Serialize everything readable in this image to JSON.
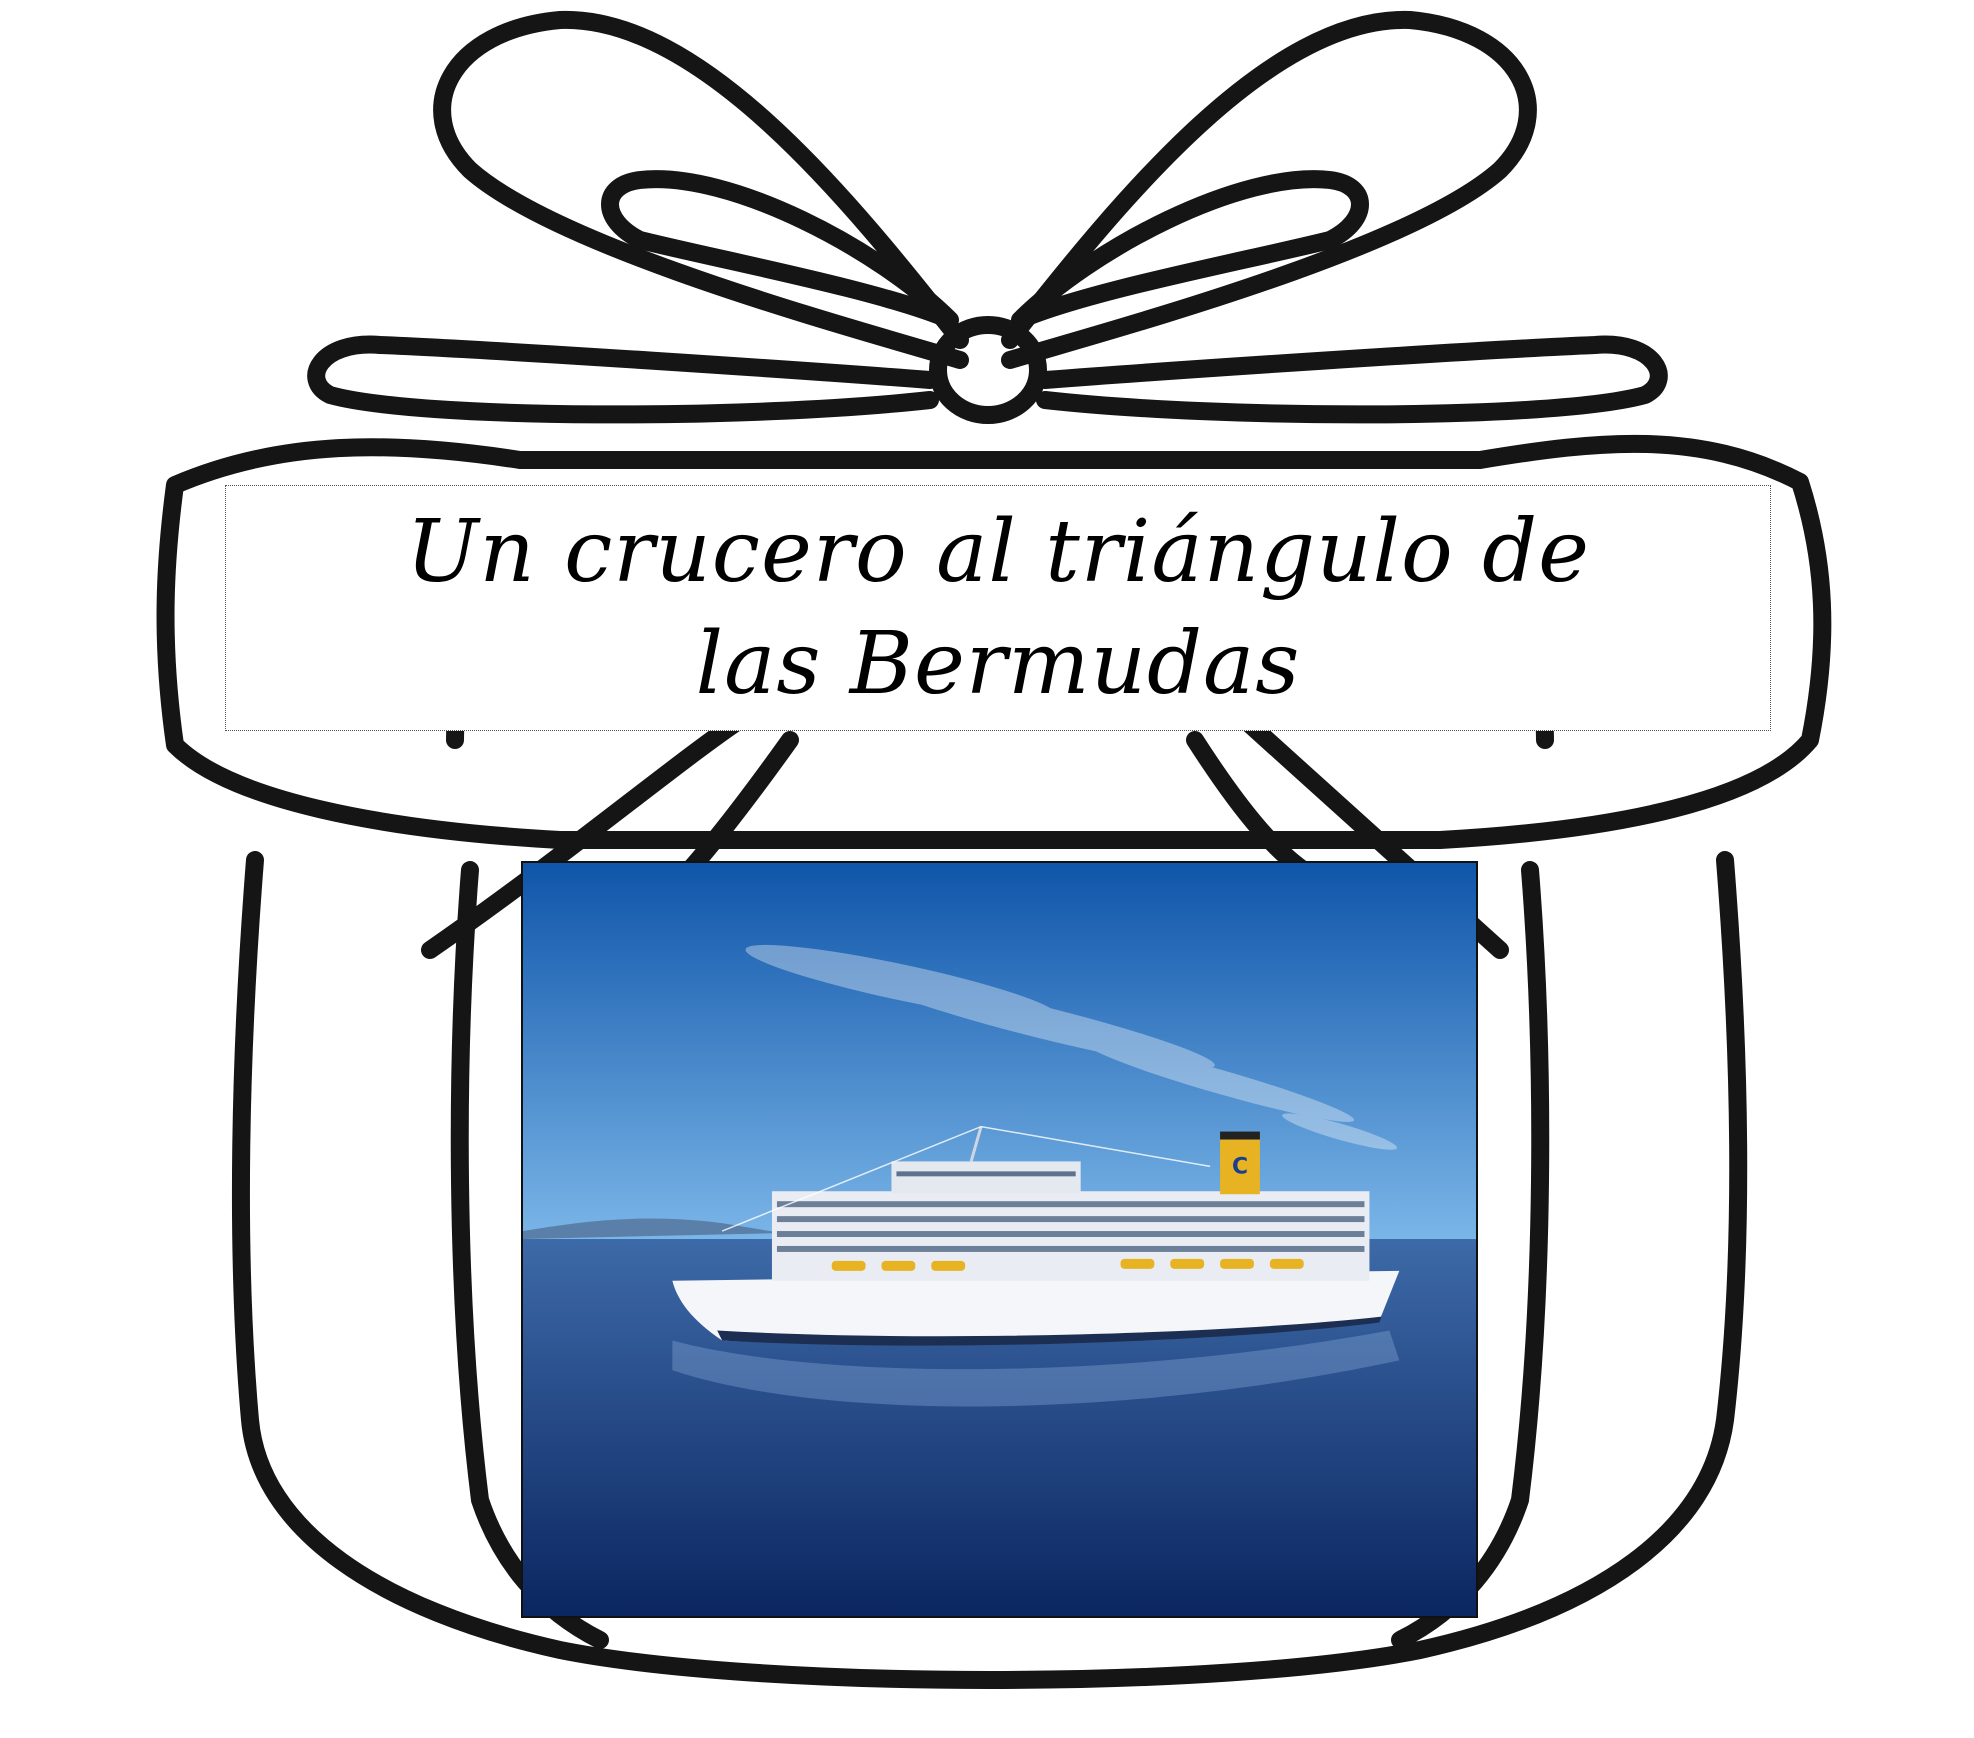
{
  "title": {
    "text": "Un crucero al triángulo de las Bermudas"
  },
  "photo": {
    "subject": "cruise-ship"
  },
  "colors": {
    "outline": "#151515",
    "sky_top": "#0f55a9",
    "sky_bottom": "#7bb6e8",
    "sea_top": "#3d6aa8",
    "sea_bottom": "#0b2660",
    "funnel": "#e8b323"
  }
}
